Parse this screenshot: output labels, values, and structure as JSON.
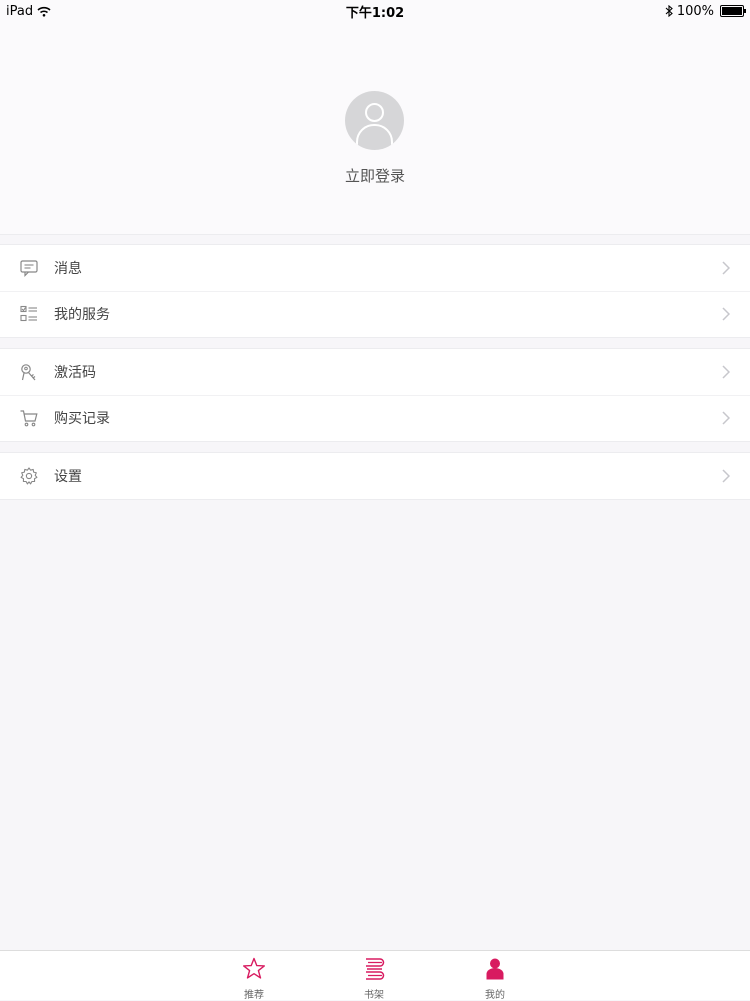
{
  "status_bar": {
    "device": "iPad",
    "time": "下午1:02",
    "battery": "100%"
  },
  "profile": {
    "login_label": "立即登录",
    "avatar_icon": "default-avatar-icon"
  },
  "menu": {
    "messages": "消息",
    "my_services": "我的服务",
    "activation_code": "激活码",
    "purchase_history": "购买记录",
    "settings": "设置"
  },
  "tabs": {
    "recommend": "推荐",
    "bookshelf": "书架",
    "mine": "我的",
    "active_tab": "我的"
  },
  "colors": {
    "accent": "#d81b60",
    "icon_gray": "#888888",
    "chevron": "#c7c7cc"
  },
  "icons": {
    "messages": "chat-bubble-icon",
    "my_services": "checklist-icon",
    "activation_code": "key-icon",
    "purchase_history": "cart-icon",
    "settings": "gear-icon",
    "recommend": "star-icon",
    "bookshelf": "books-icon",
    "mine": "person-icon"
  }
}
